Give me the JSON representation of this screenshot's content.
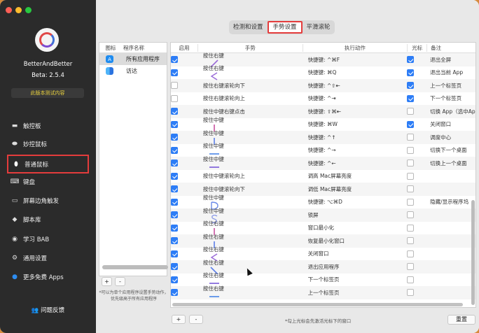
{
  "sidebar": {
    "app_name": "BetterAndBetter",
    "version": "Beta: 2.5.4",
    "test_label": "此版本测试内容",
    "items": [
      {
        "label": "触控板",
        "icon": "trackpad-icon"
      },
      {
        "label": "妙控鼠标",
        "icon": "magic-mouse-icon"
      },
      {
        "label": "普通鼠标",
        "icon": "mouse-icon",
        "active": true
      },
      {
        "label": "键盘",
        "icon": "keyboard-icon"
      },
      {
        "label": "屏幕边角触发",
        "icon": "screen-corner-icon"
      },
      {
        "label": "脚本库",
        "icon": "script-icon"
      },
      {
        "label": "学习 BAB",
        "icon": "learn-icon"
      },
      {
        "label": "通用设置",
        "icon": "gear-icon"
      },
      {
        "label": "更多免费 Apps",
        "icon": "app-store-icon"
      }
    ],
    "feedback": "问题反馈"
  },
  "tabs": [
    "检测和设置",
    "手势设置",
    "平滑滚轮"
  ],
  "selected_tab": "手势设置",
  "apps_panel": {
    "headers": [
      "图标",
      "程序名称"
    ],
    "rows": [
      {
        "name": "所有应用程序",
        "icon": "app-store-icon"
      },
      {
        "name": "访达",
        "icon": "finder-icon"
      }
    ],
    "add": "+",
    "remove": "-",
    "note": "*可以为单个应用程序设置手势动作，优先级高于所有应用程序"
  },
  "gesture_table": {
    "headers": [
      "启用",
      "手势",
      "执行动作",
      "光标",
      "备注"
    ],
    "rows": [
      {
        "enabled": true,
        "gesture": "按住右键",
        "glyph": "diag-up-right",
        "action": "快捷键: ^⌘F",
        "cursor": true,
        "note": "退出全屏"
      },
      {
        "enabled": true,
        "gesture": "按住右键",
        "glyph": "chevron-left",
        "action": "快捷键: ⌘Q",
        "cursor": true,
        "note": "退出当前 App"
      },
      {
        "enabled": false,
        "gesture": "按住右键滚轮向下",
        "glyph": "",
        "action": "快捷键: ^⇧⇤",
        "cursor": true,
        "note": "上一个标签页"
      },
      {
        "enabled": false,
        "gesture": "按住右键滚轮向上",
        "glyph": "",
        "action": "快捷键: ^⇥",
        "cursor": true,
        "note": "下一个标签页"
      },
      {
        "enabled": true,
        "gesture": "按住中键右键点击",
        "glyph": "",
        "action": "快捷键: ⇧⌘⇤",
        "cursor": false,
        "note": "切换 App（选中App）"
      },
      {
        "enabled": true,
        "gesture": "按住中键",
        "glyph": "line-up",
        "action": "快捷键: ⌘W",
        "cursor": true,
        "note": "关闭窗口"
      },
      {
        "enabled": true,
        "gesture": "按住中键",
        "glyph": "line-down",
        "action": "快捷键: ^↑",
        "cursor": false,
        "note": "调度中心"
      },
      {
        "enabled": true,
        "gesture": "按住中键",
        "glyph": "line-left",
        "action": "快捷键: ^→",
        "cursor": false,
        "note": "切换下一个桌面"
      },
      {
        "enabled": true,
        "gesture": "按住中键",
        "glyph": "line-right",
        "action": "快捷键: ^←",
        "cursor": false,
        "note": "切换上一个桌面"
      },
      {
        "enabled": true,
        "gesture": "按住中键滚轮向上",
        "glyph": "",
        "action": "调高 Mac屏幕亮度",
        "cursor": false,
        "note": ""
      },
      {
        "enabled": true,
        "gesture": "按住中键滚轮向下",
        "glyph": "",
        "action": "调低 Mac屏幕亮度",
        "cursor": false,
        "note": ""
      },
      {
        "enabled": true,
        "gesture": "按住中键",
        "glyph": "letter-d",
        "action": "快捷键: ⌥⌘D",
        "cursor": false,
        "note": "隐藏/显示程序坞"
      },
      {
        "enabled": true,
        "gesture": "按住中键",
        "glyph": "letter-s",
        "action": "锁屏",
        "cursor": false,
        "note": ""
      },
      {
        "enabled": true,
        "gesture": "按住右键",
        "glyph": "line-up",
        "action": "窗口最小化",
        "cursor": false,
        "note": ""
      },
      {
        "enabled": true,
        "gesture": "按住右键",
        "glyph": "line-down",
        "action": "恢复最小化窗口",
        "cursor": false,
        "note": ""
      },
      {
        "enabled": true,
        "gesture": "按住右键",
        "glyph": "chevron-left",
        "action": "关闭窗口",
        "cursor": false,
        "note": ""
      },
      {
        "enabled": true,
        "gesture": "按住右键",
        "glyph": "diag-down-right",
        "action": "退出应用程序",
        "cursor": false,
        "note": ""
      },
      {
        "enabled": true,
        "gesture": "按住右键",
        "glyph": "line-right",
        "action": "下一个标签页",
        "cursor": false,
        "note": ""
      },
      {
        "enabled": true,
        "gesture": "按住右键",
        "glyph": "line-left",
        "action": "上一个标签页",
        "cursor": false,
        "note": ""
      }
    ],
    "add": "+",
    "remove": "-"
  },
  "bottom_note": "*勾上光标会先激活光标下的窗口",
  "reset_label": "重置",
  "colors": {
    "accent": "#2d7df6",
    "highlight": "#e43c3c",
    "sidebar_bg": "#2b2b2b",
    "test_text": "#ead23e"
  }
}
